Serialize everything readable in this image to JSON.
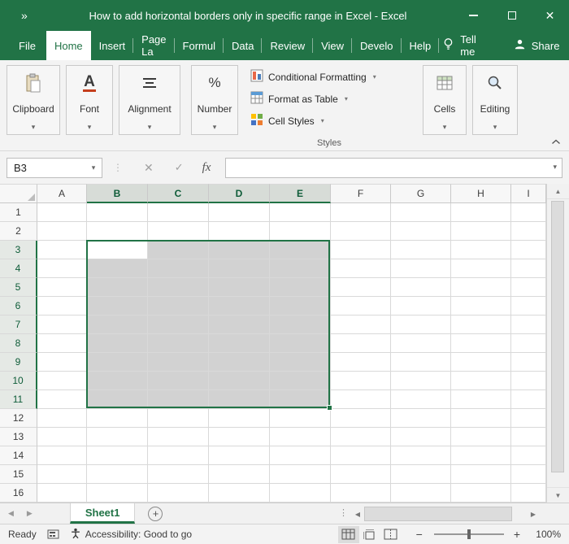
{
  "colors": {
    "excel_green": "#217346",
    "selection_fill": "#d2d2d2",
    "ribbon_bg": "#f3f3f3"
  },
  "icons": {
    "dropdown": "▾",
    "close": "✕",
    "check": "✓",
    "dots": "⋮",
    "up": "▲",
    "down": "▼",
    "left": "◀",
    "right": "▶",
    "minus": "−",
    "plus": "+",
    "percent": "%",
    "font_letter": "A"
  },
  "titlebar": {
    "overflow_glyph": "»",
    "title": "How to add horizontal borders only in specific range in Excel - Excel"
  },
  "ribbon": {
    "tabs": [
      "File",
      "Home",
      "Insert",
      "Page La",
      "Formul",
      "Data",
      "Review",
      "View",
      "Develo",
      "Help"
    ],
    "active_tab": "Home",
    "tell_me": "Tell me",
    "share": "Share",
    "groups": {
      "clipboard": "Clipboard",
      "font": "Font",
      "alignment": "Alignment",
      "number": "Number",
      "cells": "Cells",
      "editing": "Editing"
    },
    "styles": {
      "items": [
        "Conditional Formatting",
        "Format as Table",
        "Cell Styles"
      ],
      "label": "Styles"
    }
  },
  "formula_bar": {
    "name_box": "B3",
    "fx_label": "fx"
  },
  "grid": {
    "columns": [
      "A",
      "B",
      "C",
      "D",
      "E",
      "F",
      "G",
      "H",
      "I"
    ],
    "visible_rows": 16,
    "selection": {
      "range": "B3:E11",
      "active_cell": "B3",
      "selected_columns": [
        "B",
        "C",
        "D",
        "E"
      ],
      "selected_rows_start": 3,
      "selected_rows_end": 11
    }
  },
  "sheet_tabs": {
    "tabs": [
      "Sheet1"
    ],
    "active": "Sheet1",
    "add_glyph": "+"
  },
  "status_bar": {
    "mode": "Ready",
    "accessibility": "Accessibility: Good to go",
    "zoom": {
      "minus": "−",
      "plus": "+",
      "level": "100%"
    }
  }
}
